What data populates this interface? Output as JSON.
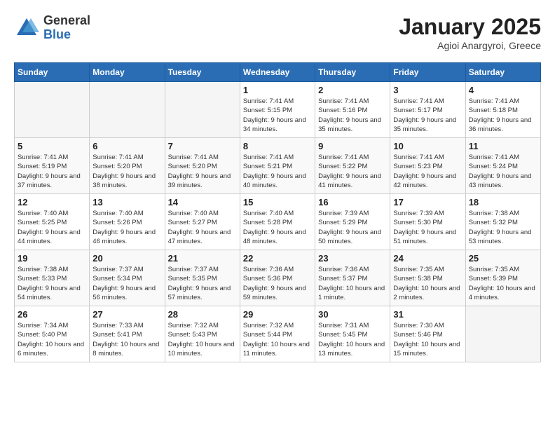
{
  "header": {
    "logo_general": "General",
    "logo_blue": "Blue",
    "title": "January 2025",
    "subtitle": "Agioi Anargyroi, Greece"
  },
  "calendar": {
    "days_of_week": [
      "Sunday",
      "Monday",
      "Tuesday",
      "Wednesday",
      "Thursday",
      "Friday",
      "Saturday"
    ],
    "weeks": [
      [
        {
          "day": "",
          "info": ""
        },
        {
          "day": "",
          "info": ""
        },
        {
          "day": "",
          "info": ""
        },
        {
          "day": "1",
          "info": "Sunrise: 7:41 AM\nSunset: 5:15 PM\nDaylight: 9 hours\nand 34 minutes."
        },
        {
          "day": "2",
          "info": "Sunrise: 7:41 AM\nSunset: 5:16 PM\nDaylight: 9 hours\nand 35 minutes."
        },
        {
          "day": "3",
          "info": "Sunrise: 7:41 AM\nSunset: 5:17 PM\nDaylight: 9 hours\nand 35 minutes."
        },
        {
          "day": "4",
          "info": "Sunrise: 7:41 AM\nSunset: 5:18 PM\nDaylight: 9 hours\nand 36 minutes."
        }
      ],
      [
        {
          "day": "5",
          "info": "Sunrise: 7:41 AM\nSunset: 5:19 PM\nDaylight: 9 hours\nand 37 minutes."
        },
        {
          "day": "6",
          "info": "Sunrise: 7:41 AM\nSunset: 5:20 PM\nDaylight: 9 hours\nand 38 minutes."
        },
        {
          "day": "7",
          "info": "Sunrise: 7:41 AM\nSunset: 5:20 PM\nDaylight: 9 hours\nand 39 minutes."
        },
        {
          "day": "8",
          "info": "Sunrise: 7:41 AM\nSunset: 5:21 PM\nDaylight: 9 hours\nand 40 minutes."
        },
        {
          "day": "9",
          "info": "Sunrise: 7:41 AM\nSunset: 5:22 PM\nDaylight: 9 hours\nand 41 minutes."
        },
        {
          "day": "10",
          "info": "Sunrise: 7:41 AM\nSunset: 5:23 PM\nDaylight: 9 hours\nand 42 minutes."
        },
        {
          "day": "11",
          "info": "Sunrise: 7:41 AM\nSunset: 5:24 PM\nDaylight: 9 hours\nand 43 minutes."
        }
      ],
      [
        {
          "day": "12",
          "info": "Sunrise: 7:40 AM\nSunset: 5:25 PM\nDaylight: 9 hours\nand 44 minutes."
        },
        {
          "day": "13",
          "info": "Sunrise: 7:40 AM\nSunset: 5:26 PM\nDaylight: 9 hours\nand 46 minutes."
        },
        {
          "day": "14",
          "info": "Sunrise: 7:40 AM\nSunset: 5:27 PM\nDaylight: 9 hours\nand 47 minutes."
        },
        {
          "day": "15",
          "info": "Sunrise: 7:40 AM\nSunset: 5:28 PM\nDaylight: 9 hours\nand 48 minutes."
        },
        {
          "day": "16",
          "info": "Sunrise: 7:39 AM\nSunset: 5:29 PM\nDaylight: 9 hours\nand 50 minutes."
        },
        {
          "day": "17",
          "info": "Sunrise: 7:39 AM\nSunset: 5:30 PM\nDaylight: 9 hours\nand 51 minutes."
        },
        {
          "day": "18",
          "info": "Sunrise: 7:38 AM\nSunset: 5:32 PM\nDaylight: 9 hours\nand 53 minutes."
        }
      ],
      [
        {
          "day": "19",
          "info": "Sunrise: 7:38 AM\nSunset: 5:33 PM\nDaylight: 9 hours\nand 54 minutes."
        },
        {
          "day": "20",
          "info": "Sunrise: 7:37 AM\nSunset: 5:34 PM\nDaylight: 9 hours\nand 56 minutes."
        },
        {
          "day": "21",
          "info": "Sunrise: 7:37 AM\nSunset: 5:35 PM\nDaylight: 9 hours\nand 57 minutes."
        },
        {
          "day": "22",
          "info": "Sunrise: 7:36 AM\nSunset: 5:36 PM\nDaylight: 9 hours\nand 59 minutes."
        },
        {
          "day": "23",
          "info": "Sunrise: 7:36 AM\nSunset: 5:37 PM\nDaylight: 10 hours\nand 1 minute."
        },
        {
          "day": "24",
          "info": "Sunrise: 7:35 AM\nSunset: 5:38 PM\nDaylight: 10 hours\nand 2 minutes."
        },
        {
          "day": "25",
          "info": "Sunrise: 7:35 AM\nSunset: 5:39 PM\nDaylight: 10 hours\nand 4 minutes."
        }
      ],
      [
        {
          "day": "26",
          "info": "Sunrise: 7:34 AM\nSunset: 5:40 PM\nDaylight: 10 hours\nand 6 minutes."
        },
        {
          "day": "27",
          "info": "Sunrise: 7:33 AM\nSunset: 5:41 PM\nDaylight: 10 hours\nand 8 minutes."
        },
        {
          "day": "28",
          "info": "Sunrise: 7:32 AM\nSunset: 5:43 PM\nDaylight: 10 hours\nand 10 minutes."
        },
        {
          "day": "29",
          "info": "Sunrise: 7:32 AM\nSunset: 5:44 PM\nDaylight: 10 hours\nand 11 minutes."
        },
        {
          "day": "30",
          "info": "Sunrise: 7:31 AM\nSunset: 5:45 PM\nDaylight: 10 hours\nand 13 minutes."
        },
        {
          "day": "31",
          "info": "Sunrise: 7:30 AM\nSunset: 5:46 PM\nDaylight: 10 hours\nand 15 minutes."
        },
        {
          "day": "",
          "info": ""
        }
      ]
    ]
  }
}
